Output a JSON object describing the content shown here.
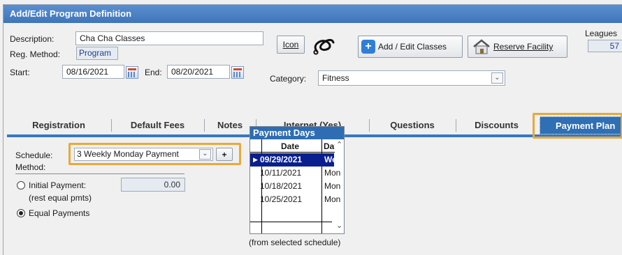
{
  "window": {
    "title": "Add/Edit Program Definition"
  },
  "form": {
    "description_label": "Description:",
    "description_value": "Cha Cha Classes",
    "reg_method_label": "Reg. Method:",
    "reg_method_value": "Program",
    "start_label": "Start:",
    "start_value": "08/16/2021",
    "end_label": "End:",
    "end_value": "08/20/2021",
    "category_label": "Category:",
    "category_value": "Fitness",
    "icon_button": "Icon",
    "add_edit_classes_button": "Add / Edit Classes",
    "reserve_facility_button": "Reserve Facility",
    "leagues_label": "Leagues",
    "leagues_value": "57"
  },
  "tabs": [
    {
      "label": "Registration"
    },
    {
      "label": "Default Fees"
    },
    {
      "label": "Notes"
    },
    {
      "label": "Internet (Yes)"
    },
    {
      "label": "Questions"
    },
    {
      "label": "Discounts"
    },
    {
      "label": "Payment Plan"
    }
  ],
  "payment_plan": {
    "schedule_label": "Schedule:",
    "schedule_value": "3 Weekly Monday Payment",
    "add_button": "+",
    "method_label": "Method:",
    "initial_payment_label": "Initial Payment:",
    "initial_payment_value": "0.00",
    "rest_equal_label": "(rest equal pmts)",
    "equal_payments_label": "Equal Payments",
    "selected_method": "Equal Payments",
    "payment_days_title": "Payment Days",
    "col_date": "Date",
    "col_day": "Day",
    "rows": [
      {
        "date": "09/29/2021",
        "day": "Wed"
      },
      {
        "date": "10/11/2021",
        "day": "Mon"
      },
      {
        "date": "10/18/2021",
        "day": "Mon"
      },
      {
        "date": "10/25/2021",
        "day": "Mon"
      }
    ],
    "footnote": "(from selected schedule)"
  },
  "colors": {
    "accent": "#2f6fb4",
    "highlight": "#e8a93a",
    "selected_row": "#0a1f8f"
  }
}
